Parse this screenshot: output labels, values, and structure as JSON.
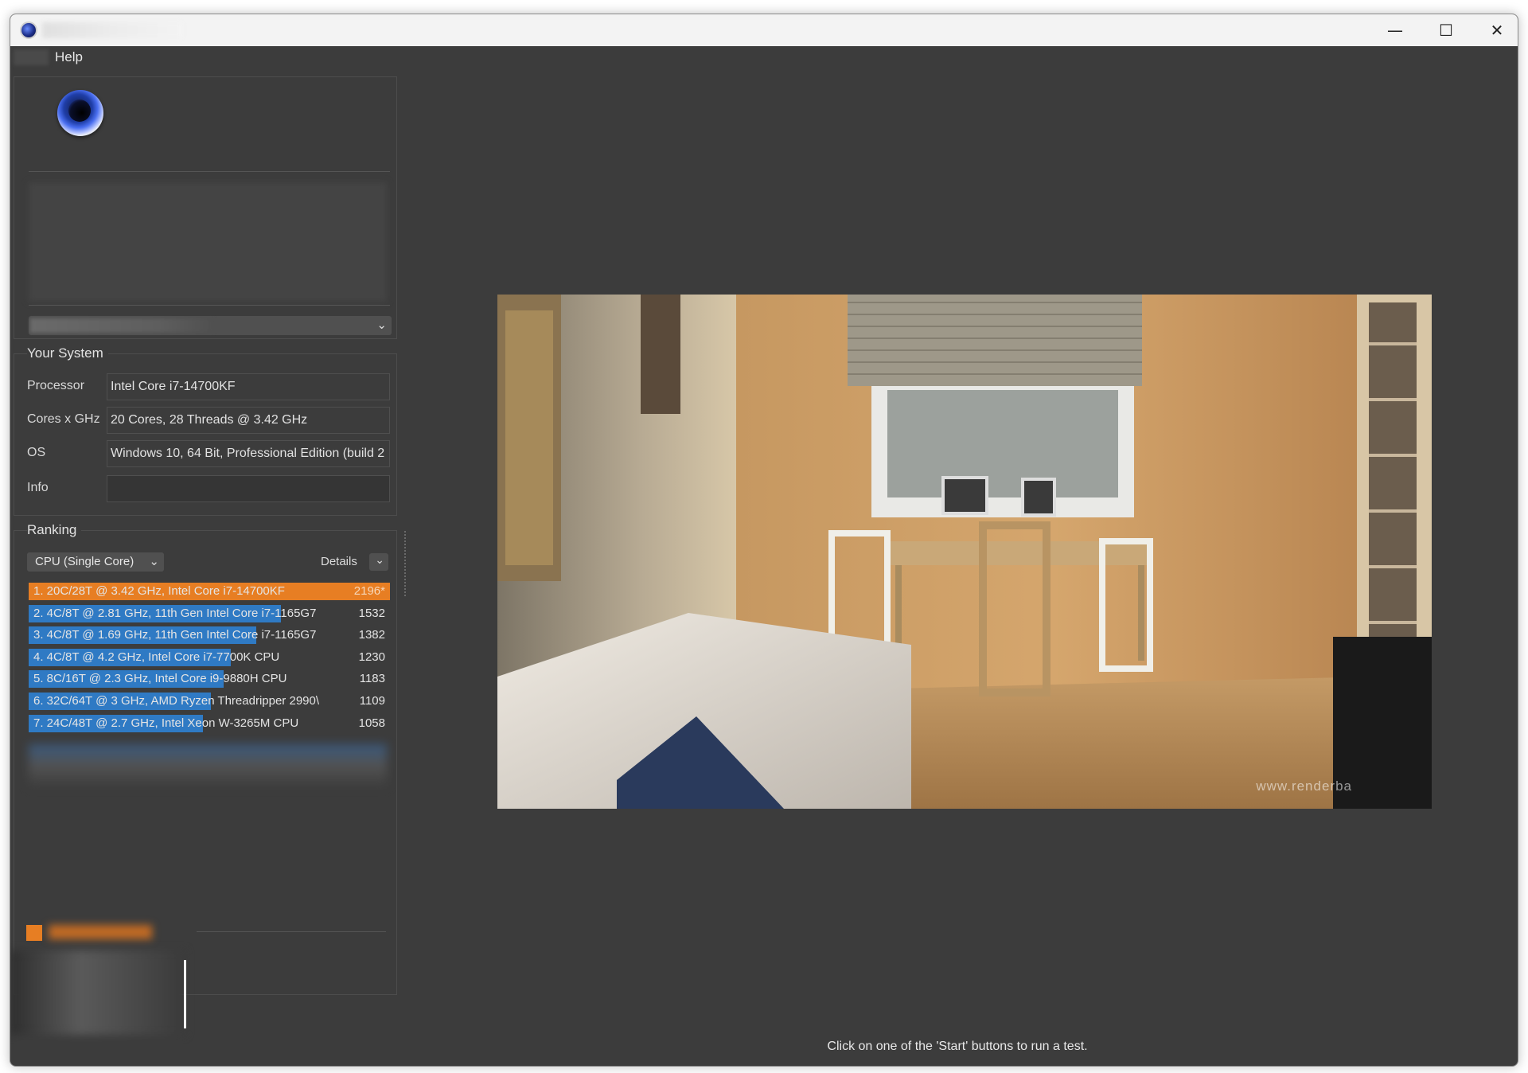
{
  "window": {
    "controls": {
      "minimize": "—",
      "maximize": "☐",
      "close": "✕"
    }
  },
  "menu": {
    "help": "Help"
  },
  "system": {
    "section_title": "Your System",
    "rows": [
      {
        "label": "Processor",
        "value": "Intel Core i7-14700KF"
      },
      {
        "label": "Cores x GHz",
        "value": "20 Cores, 28 Threads @ 3.42 GHz"
      },
      {
        "label": "OS",
        "value": "Windows 10, 64 Bit, Professional Edition (build 2"
      },
      {
        "label": "Info",
        "value": ""
      }
    ]
  },
  "ranking": {
    "section_title": "Ranking",
    "mode_select": "CPU (Single Core)",
    "details_label": "Details",
    "entries": [
      {
        "text": "1. 20C/28T @ 3.42 GHz, Intel Core i7-14700KF",
        "score": "2196*",
        "fraction": 1.0,
        "highlight": true
      },
      {
        "text": "2. 4C/8T @ 2.81 GHz, 11th Gen Intel Core i7-1165G7",
        "score": "1532",
        "fraction": 0.698,
        "highlight": false
      },
      {
        "text": "3. 4C/8T @ 1.69 GHz, 11th Gen Intel Core i7-1165G7",
        "score": "1382",
        "fraction": 0.629,
        "highlight": false
      },
      {
        "text": "4. 4C/8T @ 4.2 GHz, Intel Core i7-7700K CPU",
        "score": "1230",
        "fraction": 0.56,
        "highlight": false
      },
      {
        "text": "5. 8C/16T @ 2.3 GHz, Intel Core i9-9880H CPU",
        "score": "1183",
        "fraction": 0.539,
        "highlight": false
      },
      {
        "text": "6. 32C/64T @ 3 GHz, AMD Ryzen Threadripper 2990\\",
        "score": "1109",
        "fraction": 0.505,
        "highlight": false
      },
      {
        "text": "7. 24C/48T @ 2.7 GHz, Intel Xeon W-3265M CPU",
        "score": "1058",
        "fraction": 0.482,
        "highlight": false
      }
    ]
  },
  "preview": {
    "watermark": "www.renderba"
  },
  "status": {
    "message": "Click on one of the 'Start' buttons to run a test."
  },
  "colors": {
    "highlight": "#e77e23",
    "bar": "#2f7ac4",
    "background": "#3c3c3c"
  }
}
